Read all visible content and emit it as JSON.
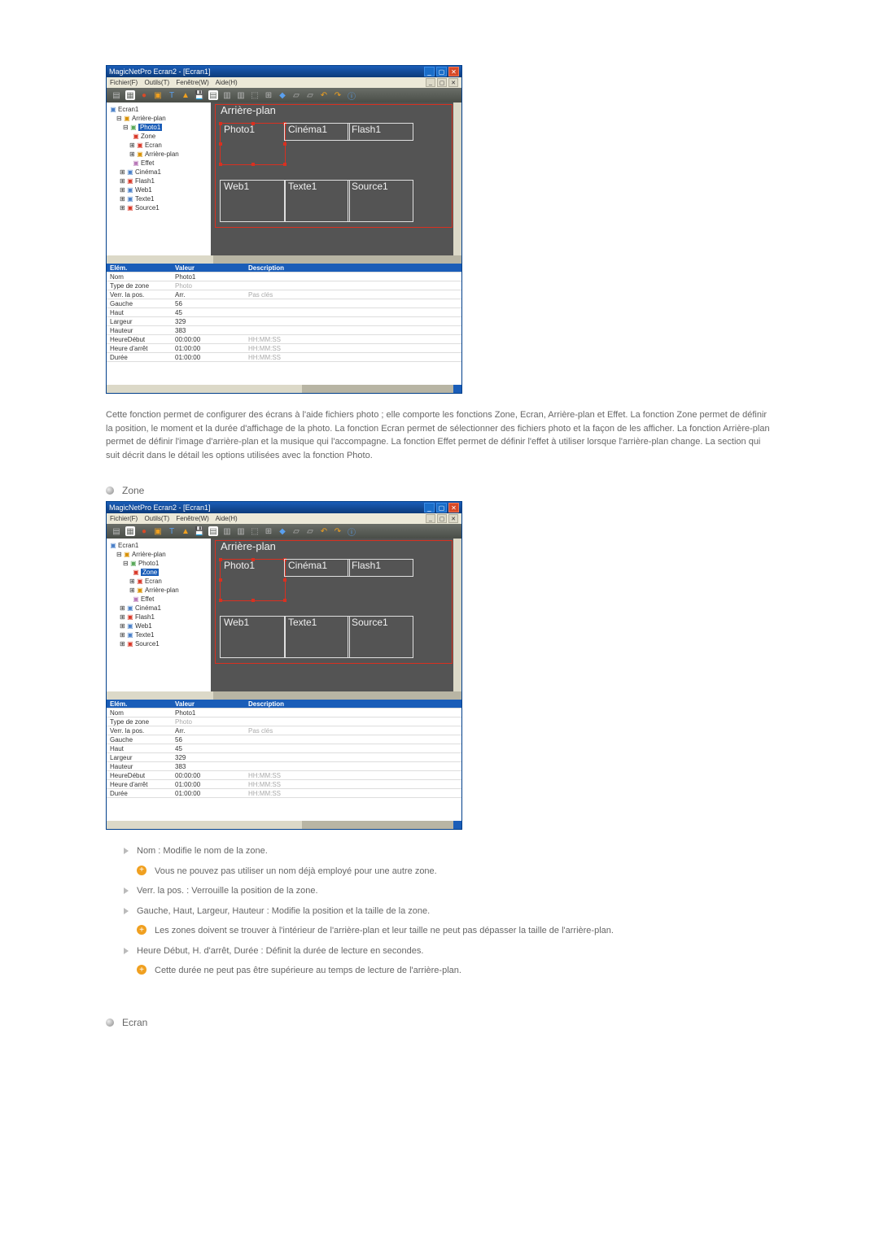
{
  "app": {
    "title1": "MagicNetPro Ecran2 - [Ecran1]",
    "title2": "MagicNetPro Ecran2 - [Ecran1]",
    "menus": [
      "Fichier(F)",
      "Outils(T)",
      "Fenêtre(W)",
      "Aide(H)"
    ]
  },
  "tree": {
    "root": "Ecran1",
    "items": [
      {
        "label": "Ecran1",
        "icon": "blue"
      },
      {
        "label": "Arrière-plan",
        "icon": "folder",
        "indent": 1
      },
      {
        "label": "Photo1",
        "icon": "green",
        "indent": 2,
        "selected": 1
      },
      {
        "label": "Zone",
        "icon": "red",
        "indent": 3,
        "selected": 2
      },
      {
        "label": "Ecran",
        "icon": "red",
        "indent": 3
      },
      {
        "label": "Arrière-plan",
        "icon": "folder",
        "indent": 3
      },
      {
        "label": "Effet",
        "icon": "purple",
        "indent": 3
      },
      {
        "label": "Cinéma1",
        "icon": "blue",
        "indent": 2
      },
      {
        "label": "Flash1",
        "icon": "red",
        "indent": 2
      },
      {
        "label": "Web1",
        "icon": "blue",
        "indent": 2
      },
      {
        "label": "Texte1",
        "icon": "blue",
        "indent": 2
      },
      {
        "label": "Source1",
        "icon": "red",
        "indent": 2
      }
    ]
  },
  "canvas": {
    "bg_label": "Arrière-plan",
    "zones": [
      "Photo1",
      "Cinéma1",
      "Flash1",
      "Web1",
      "Texte1",
      "Source1"
    ]
  },
  "props": {
    "headers": [
      "Elém.",
      "Valeur",
      "Description"
    ],
    "rows": [
      {
        "k": "Nom",
        "v": "Photo1",
        "d": ""
      },
      {
        "k": "Type de zone",
        "v": "Photo",
        "d": "",
        "gray_v": true
      },
      {
        "k": "Verr. la pos.",
        "v": "Arr.",
        "d": "Pas clés",
        "gray_d": true
      },
      {
        "k": "Gauche",
        "v": "56",
        "d": ""
      },
      {
        "k": "Haut",
        "v": "45",
        "d": ""
      },
      {
        "k": "Largeur",
        "v": "329",
        "d": ""
      },
      {
        "k": "Hauteur",
        "v": "383",
        "d": ""
      },
      {
        "k": "HeureDébut",
        "v": "00:00:00",
        "d": "HH:MM:SS",
        "gray_d": true
      },
      {
        "k": "Heure d'arrêt",
        "v": "01:00:00",
        "d": "HH:MM:SS",
        "gray_d": true
      },
      {
        "k": "Durée",
        "v": "01:00:00",
        "d": "HH:MM:SS",
        "gray_d": true
      }
    ]
  },
  "desc1": "Cette fonction permet de configurer des écrans à l'aide fichiers photo ; elle comporte les fonctions Zone, Ecran, Arrière-plan et Effet. La fonction Zone permet de définir la position, le moment et la durée d'affichage de la photo. La fonction Ecran permet de sélectionner des fichiers photo et la façon de les afficher. La fonction Arrière-plan permet de définir l'image d'arrière-plan et la musique qui l'accompagne. La fonction Effet permet de définir l'effet à utiliser lorsque l'arrière-plan change. La section qui suit décrit dans le détail les options utilisées avec la fonction Photo.",
  "sections": {
    "zone": "Zone",
    "ecran": "Ecran"
  },
  "bullets": {
    "b1": "Nom : Modifie le nom de la zone.",
    "b1n": "Vous ne pouvez pas utiliser un nom déjà employé pour une autre zone.",
    "b2": "Verr. la pos. : Verrouille la position de la zone.",
    "b3": "Gauche, Haut, Largeur, Hauteur : Modifie la position et la taille de la zone.",
    "b3n": "Les zones doivent se trouver à l'intérieur de l'arrière-plan et leur taille ne peut pas dépasser la taille de l'arrière-plan.",
    "b4": "Heure Début, H. d'arrêt, Durée : Définit la durée de lecture en secondes.",
    "b4n": "Cette durée ne peut pas être supérieure au temps de lecture de l'arrière-plan."
  }
}
